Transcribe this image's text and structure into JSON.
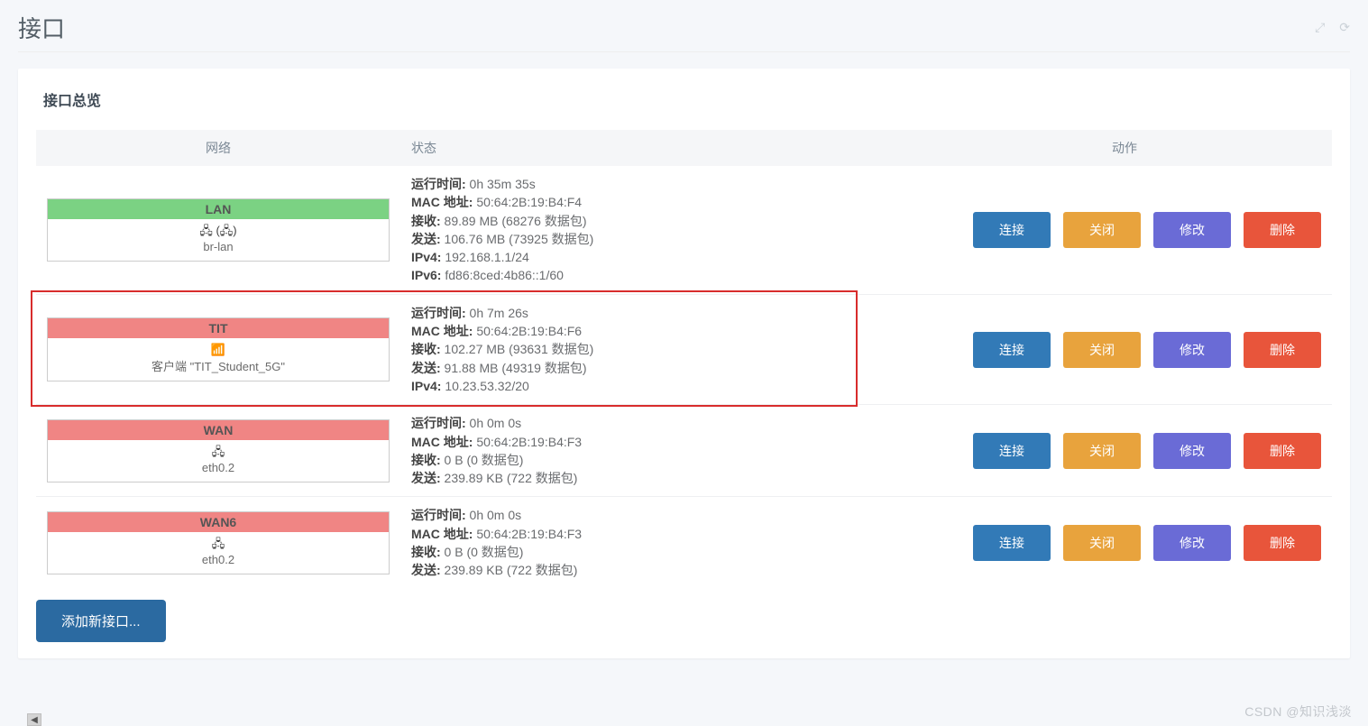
{
  "page": {
    "title": "接口",
    "watermark": "CSDN @知识浅淡"
  },
  "panel": {
    "title": "接口总览",
    "columns": {
      "network": "网络",
      "status": "状态",
      "actions": "动作"
    },
    "add_button": "添加新接口..."
  },
  "buttons": {
    "connect": "连接",
    "shutdown": "关闭",
    "edit": "修改",
    "delete": "删除"
  },
  "labels": {
    "uptime": "运行时间:",
    "mac": "MAC 地址:",
    "rx": "接收:",
    "tx": "发送:",
    "ipv4": "IPv4:",
    "ipv6": "IPv6:"
  },
  "interfaces": [
    {
      "name": "LAN",
      "color": "green",
      "icons": "🖧 (🖧)",
      "device": "br-lan",
      "highlight": false,
      "status": {
        "uptime": "0h 35m 35s",
        "mac": "50:64:2B:19:B4:F4",
        "rx": "89.89 MB (68276 数据包)",
        "tx": "106.76 MB (73925 数据包)",
        "ipv4": "192.168.1.1/24",
        "ipv6": "fd86:8ced:4b86::1/60"
      }
    },
    {
      "name": "TIT",
      "color": "red",
      "icons": "📶",
      "device": "客户端 \"TIT_Student_5G\"",
      "highlight": true,
      "status": {
        "uptime": "0h 7m 26s",
        "mac": "50:64:2B:19:B4:F6",
        "rx": "102.27 MB (93631 数据包)",
        "tx": "91.88 MB (49319 数据包)",
        "ipv4": "10.23.53.32/20"
      }
    },
    {
      "name": "WAN",
      "color": "red",
      "icons": "🖧",
      "device": "eth0.2",
      "highlight": false,
      "status": {
        "uptime": "0h 0m 0s",
        "mac": "50:64:2B:19:B4:F3",
        "rx": "0 B (0 数据包)",
        "tx": "239.89 KB (722 数据包)"
      }
    },
    {
      "name": "WAN6",
      "color": "red",
      "icons": "🖧",
      "device": "eth0.2",
      "highlight": false,
      "status": {
        "uptime": "0h 0m 0s",
        "mac": "50:64:2B:19:B4:F3",
        "rx": "0 B (0 数据包)",
        "tx": "239.89 KB (722 数据包)"
      }
    }
  ]
}
